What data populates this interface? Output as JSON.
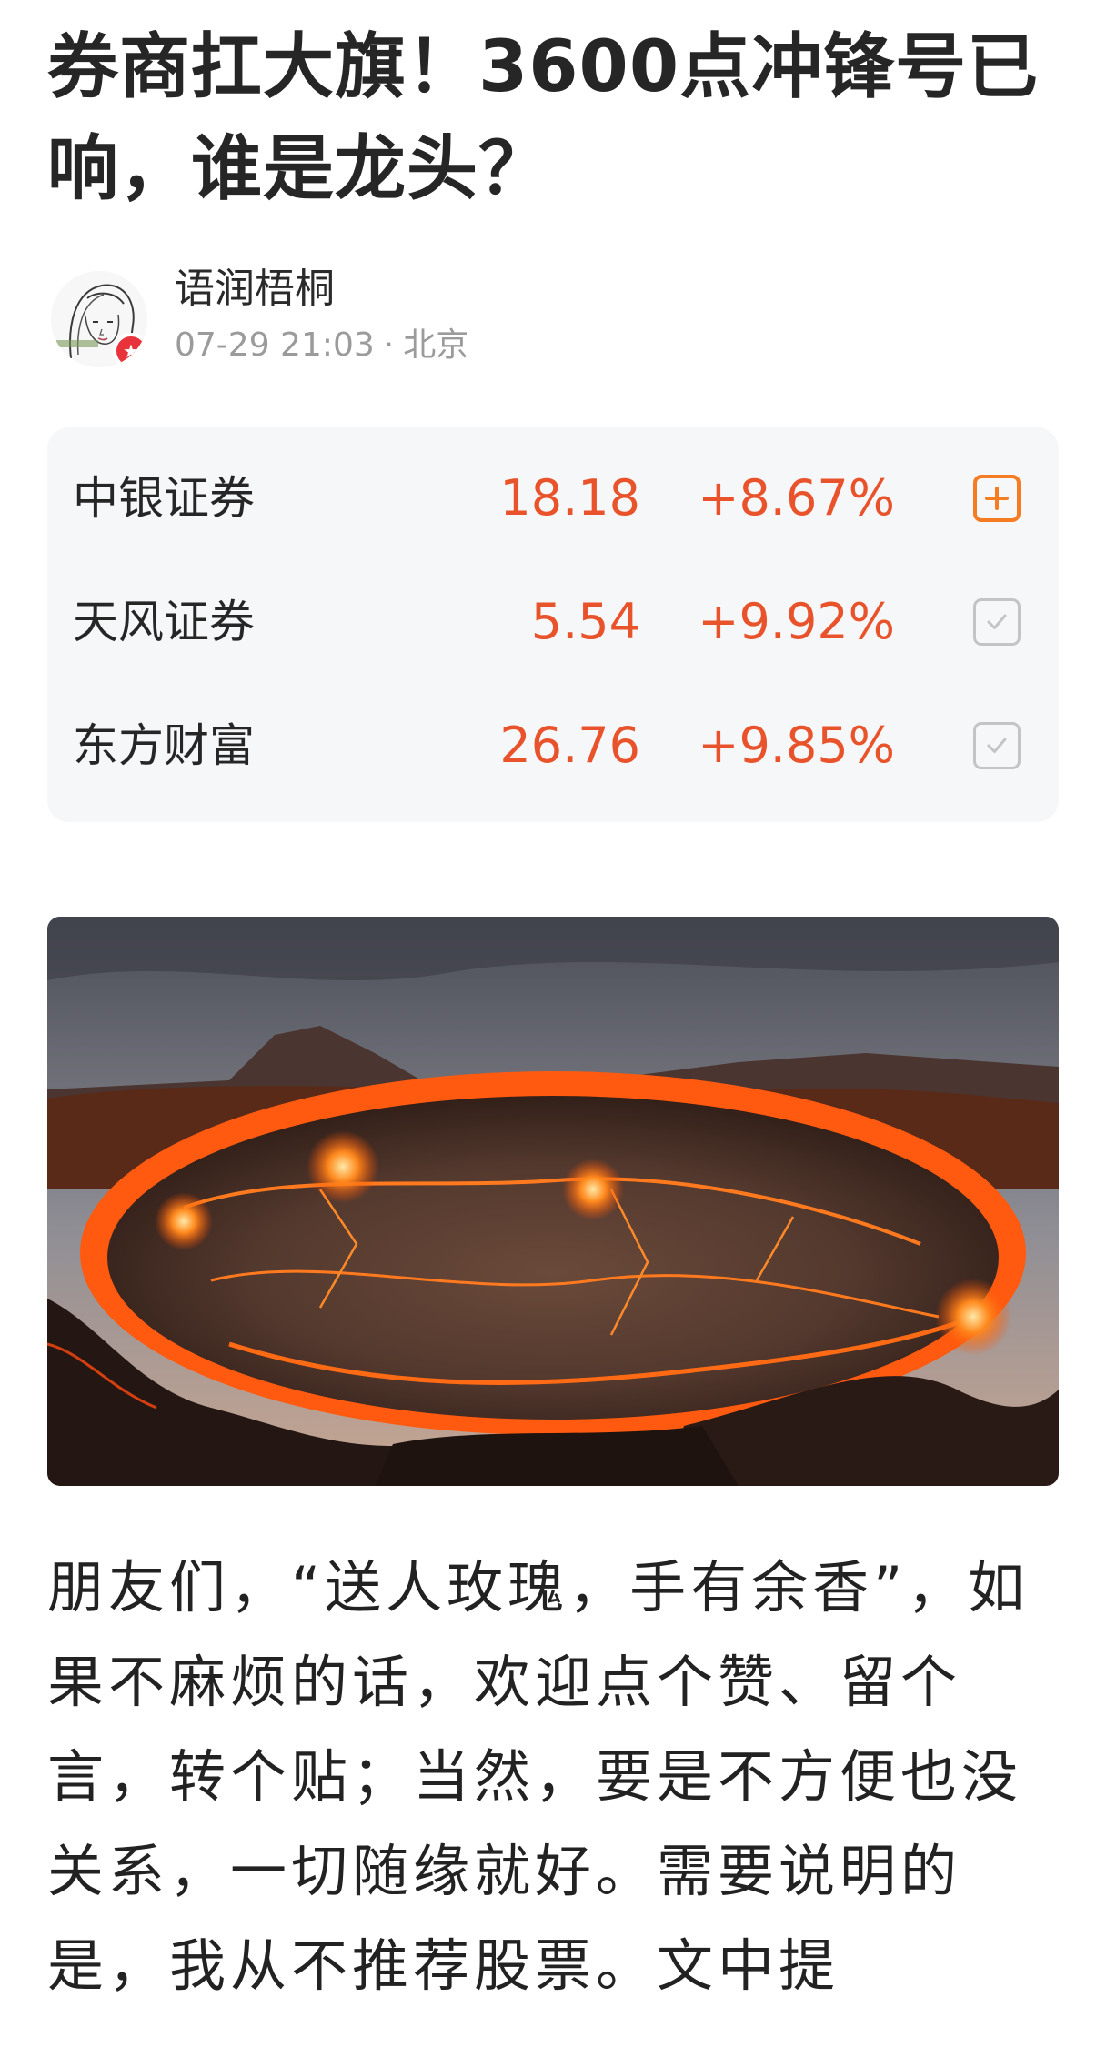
{
  "article": {
    "title": "券商扛大旗！3600点冲锋号已响，谁是龙头？",
    "body": "朋友们，“送人玫瑰，手有余香”，如果不麻烦的话，欢迎点个赞、留个言，转个贴；当然，要是不方便也没关系，一切随缘就好。需要说明的是，我从不推荐股票。文中提"
  },
  "author": {
    "name": "语润梧桐",
    "time": "07-29 21:03",
    "separator": "·",
    "location": "北京",
    "avatar_icon": "avatar-sketch-girl",
    "badge_icon": "star-icon"
  },
  "stocks": [
    {
      "name": "中银证券",
      "price": "18.18",
      "change": "+8.67%",
      "action": "add",
      "icon": "plus-square-icon"
    },
    {
      "name": "天风证券",
      "price": "5.54",
      "change": "+9.92%",
      "action": "added",
      "icon": "check-square-icon"
    },
    {
      "name": "东方财富",
      "price": "26.76",
      "change": "+9.85%",
      "action": "added",
      "icon": "check-square-icon"
    }
  ],
  "colors": {
    "up": "#e8532b",
    "add_accent": "#f57c22",
    "card_bg": "#f6f7f9",
    "meta_gray": "#9b9b9b"
  }
}
